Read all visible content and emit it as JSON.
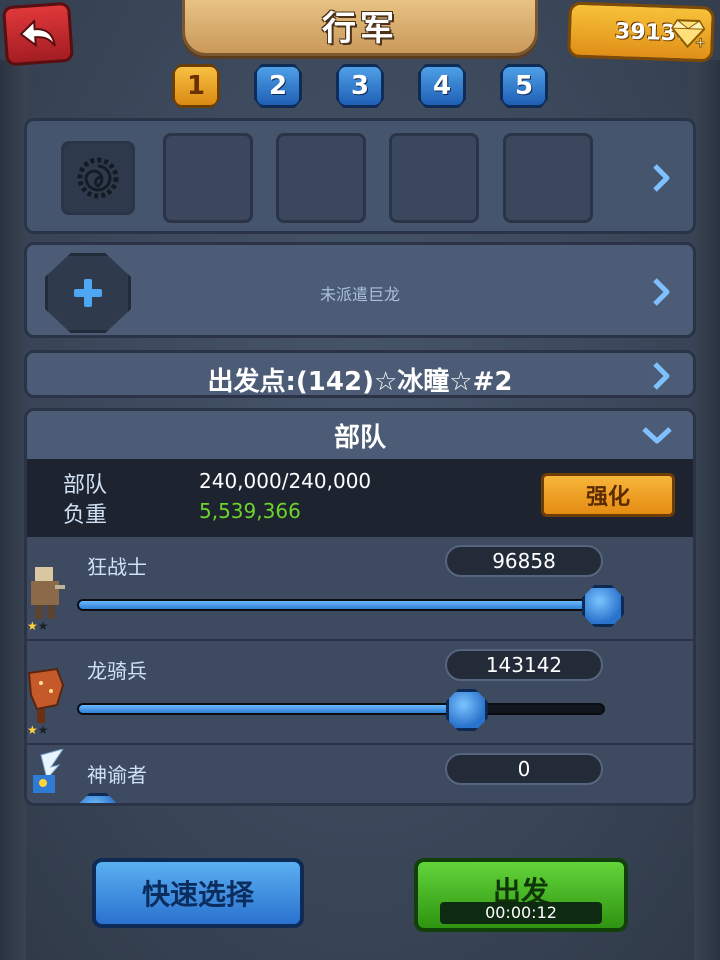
{
  "header": {
    "title": "行军",
    "gems": "39130"
  },
  "slot_tabs": [
    "1",
    "2",
    "3",
    "4",
    "5"
  ],
  "active_tab": "1",
  "dragon": {
    "text": "未派遣巨龙"
  },
  "origin": {
    "text": "出发点:(142)☆冰瞳☆#2"
  },
  "troops": {
    "title": "部队",
    "summary": {
      "troops_label": "部队",
      "troops_value": "240,000/240,000",
      "load_label": "负重",
      "load_value": "5,539,366",
      "boost_label": "强化"
    },
    "units": [
      {
        "name": "狂战士",
        "count": "96858",
        "fraction": 1.0,
        "stars": "★★"
      },
      {
        "name": "龙骑兵",
        "count": "143142",
        "fraction": 0.74,
        "stars": "★★"
      },
      {
        "name": "神谕者",
        "count": "0",
        "fraction": 0.0,
        "stars": ""
      }
    ]
  },
  "buttons": {
    "quick_select": "快速选择",
    "march": "出发",
    "timer": "00:00:12"
  },
  "colors": {
    "accent_gold": "#f7b63a",
    "accent_blue": "#2f7ed3",
    "accent_green": "#2f9412",
    "load_green": "#6cd42c"
  }
}
